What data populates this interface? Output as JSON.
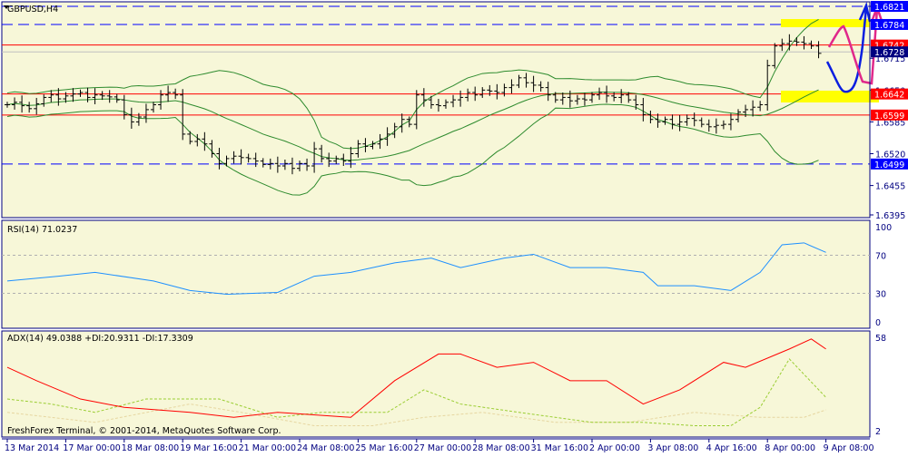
{
  "header": {
    "symbol_label": "GBPUSD,H4"
  },
  "colors": {
    "background": "#f7f7d8",
    "frame": "#000080",
    "bands": "#2e8b2e",
    "rsi": "#1e90ff",
    "adx": "#ff0000",
    "plus_di": "#9acd32",
    "minus_di": "#e6d6a0",
    "red_level": "#ff0000",
    "blue_level": "#0000ff",
    "highlight": "#ffff00"
  },
  "price_axis": {
    "ticks": [
      "1.6821",
      "1.6715",
      "1.6650",
      "1.6585",
      "1.6520",
      "1.6455",
      "1.6395"
    ],
    "markers": [
      {
        "label": "1.6821",
        "color": "#0000ff"
      },
      {
        "label": "1.6784",
        "color": "#0000ff"
      },
      {
        "label": "1.6742",
        "color": "#ff0000"
      },
      {
        "label": "1.6728",
        "color": "#000080"
      },
      {
        "label": "1.6642",
        "color": "#ff0000"
      },
      {
        "label": "1.6599",
        "color": "#ff0000"
      },
      {
        "label": "1.6499",
        "color": "#0000ff"
      }
    ]
  },
  "levels": {
    "blue_dashed": [
      1.6821,
      1.6784,
      1.6499
    ],
    "red_solid": [
      1.6742,
      1.6642,
      1.6599
    ],
    "current_price": 1.6728
  },
  "closes": [
    1.662,
    1.6625,
    1.6618,
    1.6612,
    1.6622,
    1.6635,
    1.664,
    1.6632,
    1.6638,
    1.6642,
    1.6645,
    1.6635,
    1.664,
    1.6638,
    1.6636,
    1.663,
    1.66,
    1.6585,
    1.6595,
    1.661,
    1.662,
    1.664,
    1.6645,
    1.664,
    1.656,
    1.6545,
    1.655,
    1.654,
    1.652,
    1.65,
    1.651,
    1.6515,
    1.6512,
    1.651,
    1.6505,
    1.6498,
    1.65,
    1.6495,
    1.65,
    1.649,
    1.65,
    1.6495,
    1.653,
    1.651,
    1.6505,
    1.651,
    1.6505,
    1.652,
    1.654,
    1.6535,
    1.654,
    1.655,
    1.656,
    1.6575,
    1.659,
    1.658,
    1.664,
    1.663,
    1.662,
    1.6618,
    1.6625,
    1.663,
    1.6635,
    1.6645,
    1.664,
    1.665,
    1.6648,
    1.6645,
    1.6655,
    1.666,
    1.6675,
    1.6665,
    1.666,
    1.6655,
    1.664,
    1.663,
    1.6635,
    1.6628,
    1.6632,
    1.663,
    1.664,
    1.6645,
    1.6638,
    1.6635,
    1.664,
    1.663,
    1.662,
    1.66,
    1.659,
    1.6585,
    1.659,
    1.658,
    1.6585,
    1.6592,
    1.6588,
    1.658,
    1.6575,
    1.6578,
    1.658,
    1.659,
    1.6605,
    1.661,
    1.6615,
    1.662,
    1.67,
    1.674,
    1.6745,
    1.675,
    1.6748,
    1.6745,
    1.674,
    1.6725
  ],
  "rsi": {
    "label": "RSI(14) 71.0237",
    "ticks": [
      "100",
      "70",
      "30",
      "0"
    ],
    "points": [
      [
        0,
        43
      ],
      [
        7,
        48
      ],
      [
        12,
        52
      ],
      [
        20,
        43
      ],
      [
        25,
        33
      ],
      [
        30,
        29
      ],
      [
        37,
        31
      ],
      [
        42,
        48
      ],
      [
        47,
        52
      ],
      [
        53,
        62
      ],
      [
        58,
        67
      ],
      [
        62,
        57
      ],
      [
        68,
        67
      ],
      [
        72,
        71
      ],
      [
        77,
        57
      ],
      [
        82,
        57
      ],
      [
        87,
        52
      ],
      [
        89,
        38
      ],
      [
        94,
        38
      ],
      [
        99,
        33
      ],
      [
        103,
        52
      ],
      [
        106,
        81
      ],
      [
        109,
        83
      ],
      [
        112,
        73
      ]
    ]
  },
  "adx": {
    "label": "ADX(14) 49.0388 +DI:20.9311 -DI:17.3309",
    "ticks": [
      "58",
      "2"
    ],
    "adx_points": [
      [
        0,
        40
      ],
      [
        4,
        32
      ],
      [
        10,
        21
      ],
      [
        16,
        16
      ],
      [
        25,
        13
      ],
      [
        31,
        10
      ],
      [
        37,
        13
      ],
      [
        47,
        10
      ],
      [
        53,
        32
      ],
      [
        59,
        48
      ],
      [
        62,
        48
      ],
      [
        67,
        40
      ],
      [
        72,
        43
      ],
      [
        77,
        32
      ],
      [
        82,
        32
      ],
      [
        87,
        18
      ],
      [
        92,
        26.5
      ],
      [
        98,
        43
      ],
      [
        101,
        40
      ],
      [
        107,
        51
      ],
      [
        110,
        57
      ],
      [
        112,
        51
      ]
    ],
    "plus_di_points": [
      [
        0,
        21
      ],
      [
        6,
        18
      ],
      [
        12,
        13
      ],
      [
        19,
        21
      ],
      [
        29,
        21
      ],
      [
        37,
        10
      ],
      [
        43,
        13
      ],
      [
        52,
        13
      ],
      [
        57,
        26.5
      ],
      [
        62,
        18
      ],
      [
        70,
        13
      ],
      [
        80,
        7
      ],
      [
        87,
        7
      ],
      [
        94,
        5
      ],
      [
        99,
        5
      ],
      [
        103,
        16
      ],
      [
        107,
        45
      ],
      [
        112,
        22
      ]
    ],
    "minus_di_points": [
      [
        0,
        13
      ],
      [
        12,
        7
      ],
      [
        25,
        18
      ],
      [
        32,
        13
      ],
      [
        42,
        5
      ],
      [
        50,
        5
      ],
      [
        57,
        10
      ],
      [
        65,
        13
      ],
      [
        75,
        7
      ],
      [
        85,
        7
      ],
      [
        94,
        13
      ],
      [
        103,
        10
      ],
      [
        109,
        10
      ],
      [
        112,
        14.5
      ]
    ]
  },
  "footer": {
    "copyright": "FreshForex Terminal, © 2001-2014, MetaQuotes Software Corp."
  },
  "time_axis": [
    {
      "label": "13 Mar 2014",
      "bar": 0
    },
    {
      "label": "17 Mar 00:00",
      "bar": 8
    },
    {
      "label": "18 Mar 08:00",
      "bar": 16
    },
    {
      "label": "19 Mar 16:00",
      "bar": 24
    },
    {
      "label": "21 Mar 00:00",
      "bar": 32
    },
    {
      "label": "24 Mar 08:00",
      "bar": 40
    },
    {
      "label": "25 Mar 16:00",
      "bar": 48
    },
    {
      "label": "27 Mar 00:00",
      "bar": 56
    },
    {
      "label": "28 Mar 08:00",
      "bar": 64
    },
    {
      "label": "31 Mar 16:00",
      "bar": 72
    },
    {
      "label": "2 Apr 00:00",
      "bar": 80
    },
    {
      "label": "3 Apr 08:00",
      "bar": 88
    },
    {
      "label": "4 Apr 16:00",
      "bar": 96
    },
    {
      "label": "8 Apr 00:00",
      "bar": 104
    },
    {
      "label": "9 Apr 08:00",
      "bar": 112
    }
  ]
}
